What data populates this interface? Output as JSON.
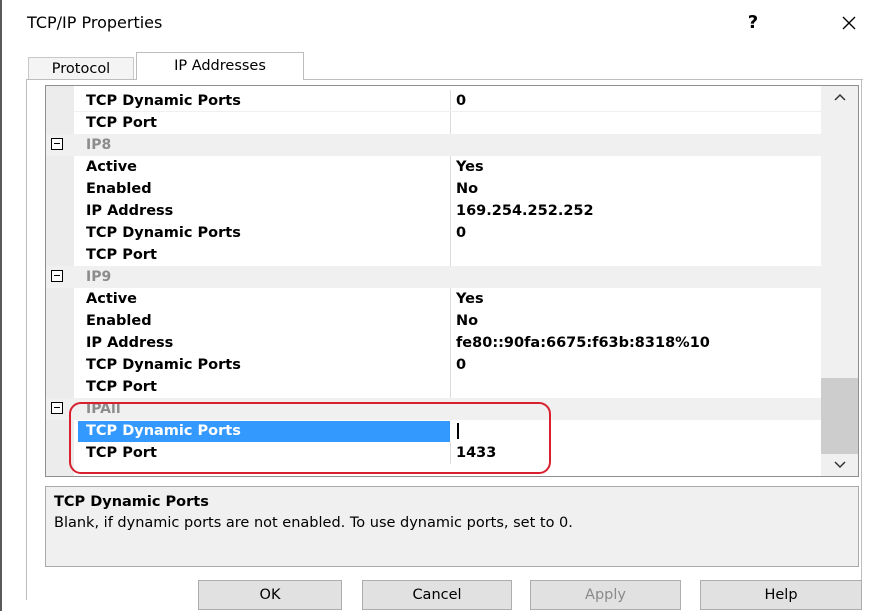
{
  "window": {
    "title": "TCP/IP Properties",
    "help_label": "?"
  },
  "tabs": [
    {
      "label": "Protocol"
    },
    {
      "label": "IP Addresses"
    }
  ],
  "grid": {
    "rows": [
      {
        "name": "TCP Dynamic Ports",
        "value": "0"
      },
      {
        "name": "TCP Port",
        "value": ""
      },
      {
        "group": "IP8"
      },
      {
        "name": "Active",
        "value": "Yes"
      },
      {
        "name": "Enabled",
        "value": "No"
      },
      {
        "name": "IP Address",
        "value": "169.254.252.252"
      },
      {
        "name": "TCP Dynamic Ports",
        "value": "0"
      },
      {
        "name": "TCP Port",
        "value": ""
      },
      {
        "group": "IP9"
      },
      {
        "name": "Active",
        "value": "Yes"
      },
      {
        "name": "Enabled",
        "value": "No"
      },
      {
        "name": "IP Address",
        "value": "fe80::90fa:6675:f63b:8318%10"
      },
      {
        "name": "TCP Dynamic Ports",
        "value": "0"
      },
      {
        "name": "TCP Port",
        "value": ""
      },
      {
        "group": "IPAll"
      },
      {
        "name": "TCP Dynamic Ports",
        "value": "",
        "selected": true
      },
      {
        "name": "TCP Port",
        "value": "1433"
      }
    ]
  },
  "description": {
    "title": "TCP Dynamic Ports",
    "text": "Blank, if dynamic ports are not enabled. To use dynamic ports, set to 0."
  },
  "buttons": {
    "ok": "OK",
    "cancel": "Cancel",
    "apply": "Apply",
    "help": "Help"
  },
  "colors": {
    "selection": "#3399ff",
    "highlight": "#d8202f"
  }
}
